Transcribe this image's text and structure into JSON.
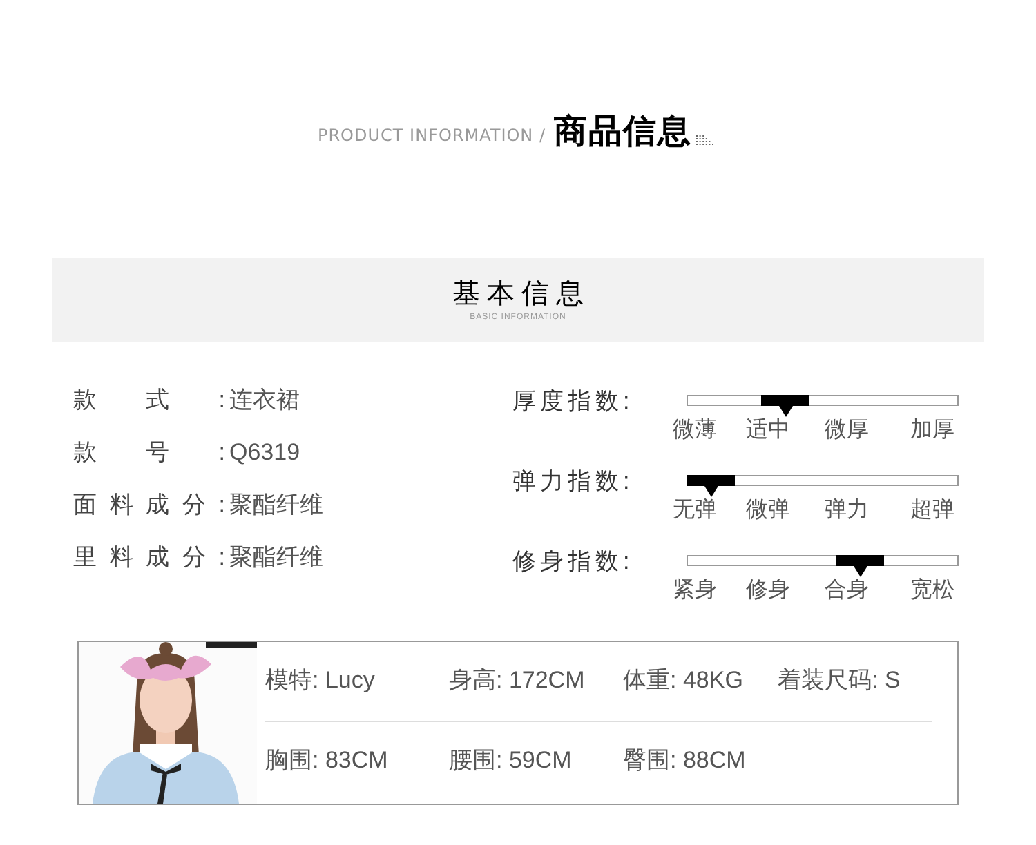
{
  "header": {
    "subtitle": "PRODUCT INFORMATION /",
    "title": "商品信息"
  },
  "section": {
    "title": "基本信息",
    "subtitle": "BASIC INFORMATION"
  },
  "attributes": [
    {
      "label": "款式:",
      "value": "连衣裙"
    },
    {
      "label": "款号:",
      "value": "Q6319"
    },
    {
      "label": "面料成分:",
      "value": "聚酯纤维"
    },
    {
      "label": "里料成分:",
      "value": "聚酯纤维"
    }
  ],
  "indices": [
    {
      "label": "厚度指数:",
      "options": [
        {
          "text": "微薄",
          "selected": false
        },
        {
          "text": "适中",
          "selected": true
        },
        {
          "text": "微厚",
          "selected": false
        },
        {
          "text": "加厚",
          "selected": false
        }
      ]
    },
    {
      "label": "弹力指数:",
      "options": [
        {
          "text": "无弹",
          "selected": true
        },
        {
          "text": "微弹",
          "selected": false
        },
        {
          "text": "弹力",
          "selected": false
        },
        {
          "text": "超弹",
          "selected": false
        }
      ]
    },
    {
      "label": "修身指数:",
      "options": [
        {
          "text": "紧身",
          "selected": false
        },
        {
          "text": "修身",
          "selected": false
        },
        {
          "text": "合身",
          "selected": true
        },
        {
          "text": "宽松",
          "selected": false
        }
      ]
    }
  ],
  "model": {
    "photo": {
      "kind": "picture"
    },
    "rows": [
      [
        "模特: Lucy",
        "身高: 172CM",
        "体重: 48KG",
        "着装尺码: S"
      ],
      [
        "胸围: 83CM",
        "腰围: 59CM",
        "臀围: 88CM"
      ]
    ]
  }
}
